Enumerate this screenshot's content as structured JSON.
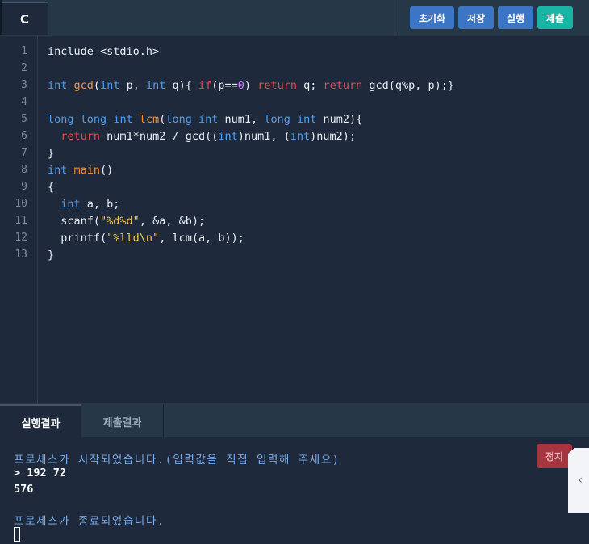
{
  "header": {
    "language_tab": "C",
    "buttons": {
      "init": "초기화",
      "save": "저장",
      "run": "실행",
      "submit": "제출"
    }
  },
  "editor": {
    "line_numbers": [
      "1",
      "2",
      "3",
      "4",
      "5",
      "6",
      "7",
      "8",
      "9",
      "10",
      "11",
      "12",
      "13"
    ],
    "lines": [
      [
        {
          "t": "include <stdio.h>",
          "c": ""
        }
      ],
      [],
      [
        {
          "t": "int",
          "c": "kw"
        },
        {
          "t": " ",
          "c": ""
        },
        {
          "t": "gcd",
          "c": "fn"
        },
        {
          "t": "(",
          "c": ""
        },
        {
          "t": "int",
          "c": "kw"
        },
        {
          "t": " p, ",
          "c": ""
        },
        {
          "t": "int",
          "c": "kw"
        },
        {
          "t": " q){ ",
          "c": ""
        },
        {
          "t": "if",
          "c": "rt"
        },
        {
          "t": "(p==",
          "c": ""
        },
        {
          "t": "0",
          "c": "num"
        },
        {
          "t": ") ",
          "c": ""
        },
        {
          "t": "return",
          "c": "rt"
        },
        {
          "t": " q; ",
          "c": ""
        },
        {
          "t": "return",
          "c": "rt"
        },
        {
          "t": " gcd(q%p, p);}",
          "c": ""
        }
      ],
      [],
      [
        {
          "t": "long",
          "c": "kw"
        },
        {
          "t": " ",
          "c": ""
        },
        {
          "t": "long",
          "c": "kw"
        },
        {
          "t": " ",
          "c": ""
        },
        {
          "t": "int",
          "c": "kw"
        },
        {
          "t": " ",
          "c": ""
        },
        {
          "t": "lcm",
          "c": "fn"
        },
        {
          "t": "(",
          "c": ""
        },
        {
          "t": "long",
          "c": "kw"
        },
        {
          "t": " ",
          "c": ""
        },
        {
          "t": "int",
          "c": "kw"
        },
        {
          "t": " num1, ",
          "c": ""
        },
        {
          "t": "long",
          "c": "kw"
        },
        {
          "t": " ",
          "c": ""
        },
        {
          "t": "int",
          "c": "kw"
        },
        {
          "t": " num2){",
          "c": ""
        }
      ],
      [
        {
          "t": "  ",
          "c": ""
        },
        {
          "t": "return",
          "c": "rt"
        },
        {
          "t": " num1*num2 / gcd((",
          "c": ""
        },
        {
          "t": "int",
          "c": "kw"
        },
        {
          "t": ")num1, (",
          "c": ""
        },
        {
          "t": "int",
          "c": "kw"
        },
        {
          "t": ")num2);",
          "c": ""
        }
      ],
      [
        {
          "t": "}",
          "c": ""
        }
      ],
      [
        {
          "t": "int",
          "c": "kw"
        },
        {
          "t": " ",
          "c": ""
        },
        {
          "t": "main",
          "c": "fn"
        },
        {
          "t": "()",
          "c": ""
        }
      ],
      [
        {
          "t": "{",
          "c": ""
        }
      ],
      [
        {
          "t": "  ",
          "c": ""
        },
        {
          "t": "int",
          "c": "kw"
        },
        {
          "t": " a, b;",
          "c": ""
        }
      ],
      [
        {
          "t": "  scanf(",
          "c": ""
        },
        {
          "t": "\"%d%d\"",
          "c": "str"
        },
        {
          "t": ", &a, &b);",
          "c": ""
        }
      ],
      [
        {
          "t": "  printf(",
          "c": ""
        },
        {
          "t": "\"%lld\\n\"",
          "c": "str"
        },
        {
          "t": ", lcm(a, b));",
          "c": ""
        }
      ],
      [
        {
          "t": "}",
          "c": ""
        }
      ]
    ]
  },
  "output": {
    "tabs": {
      "result": "실행결과",
      "submit_result": "제출결과"
    },
    "stop_button": "정지",
    "console": {
      "start_msg": "프로세스가 시작되었습니다.(입력값을 직접 입력해 주세요)",
      "input_line": "> 192 72",
      "output_line": "576",
      "end_msg": "프로세스가 종료되었습니다."
    },
    "side_handle": "‹"
  },
  "colors": {
    "keyword": "#4f9ff5",
    "function": "#f98d2f",
    "control": "#e5484d",
    "string": "#f7c84c",
    "number": "#c77dff",
    "primary_button": "#3a76c4",
    "submit_button": "#18b5a5",
    "stop_button": "#a7353f"
  }
}
